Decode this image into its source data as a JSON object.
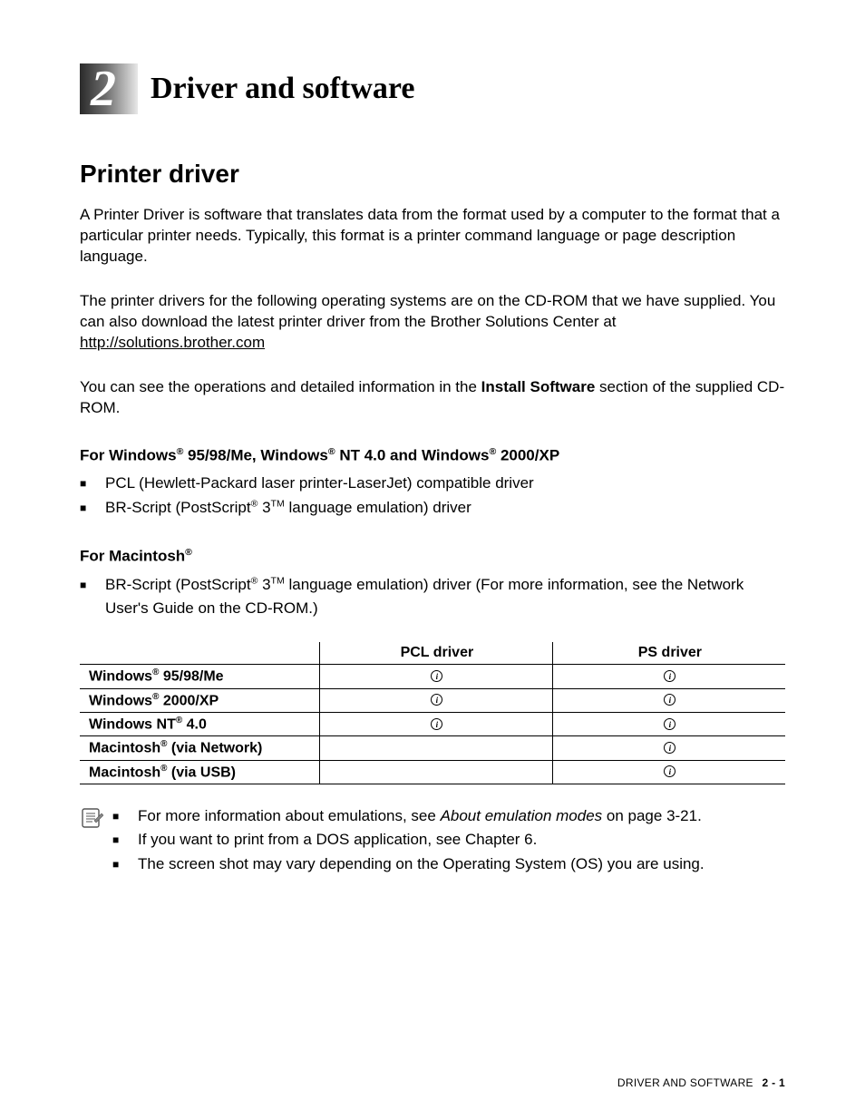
{
  "chapter": {
    "number": "2",
    "title": "Driver and software"
  },
  "section_title": "Printer driver",
  "paragraphs": {
    "p1": "A Printer Driver is software that translates data from the format used by a computer to the format that a particular printer needs. Typically, this format is a printer command language or page description language.",
    "p2a": "The printer drivers for the following operating systems are on the CD-ROM that we have supplied. You can also download the latest printer driver from the Brother Solutions Center at ",
    "p2_link": "http://solutions.brother.com",
    "p3a": "You can see the operations and detailed information in the ",
    "p3b": "Install Software",
    "p3c": " section of the supplied CD-ROM."
  },
  "windows_heading": {
    "a": "For Windows",
    "b": " 95/98/Me, Windows",
    "c": " NT 4.0 and Windows",
    "d": " 2000/XP"
  },
  "windows_bullets": {
    "b1": "PCL (Hewlett-Packard laser printer-LaserJet) compatible driver",
    "b2a": "BR-Script (PostScript",
    "b2b": " 3",
    "b2c": " language emulation) driver"
  },
  "mac_heading": "For Macintosh",
  "mac_bullets": {
    "b1a": "BR-Script (PostScript",
    "b1b": " 3",
    "b1c": " language emulation) driver (For more information, see the Network User's Guide on the CD-ROM.)"
  },
  "table": {
    "headers": {
      "col1": "",
      "col2": "PCL driver",
      "col3": "PS driver"
    },
    "rows": [
      {
        "label_a": "Windows",
        "label_b": " 95/98/Me",
        "pcl": true,
        "ps": true
      },
      {
        "label_a": "Windows",
        "label_b": " 2000/XP",
        "pcl": true,
        "ps": true
      },
      {
        "label_a": "Windows NT",
        "label_b": " 4.0",
        "pcl": true,
        "ps": true
      },
      {
        "label_a": "Macintosh",
        "label_b": " (via Network)",
        "pcl": false,
        "ps": true
      },
      {
        "label_a": "Macintosh",
        "label_b": " (via USB)",
        "pcl": false,
        "ps": true
      }
    ]
  },
  "notes": {
    "n1a": "For more information about emulations, see ",
    "n1b": "About emulation modes",
    "n1c": " on page 3-21.",
    "n2": "If you want to print from a DOS application, see Chapter 6.",
    "n3": "The screen shot may vary depending on the Operating System (OS) you are using."
  },
  "footer": {
    "label": "DRIVER AND SOFTWARE",
    "page": "2 - 1"
  },
  "reg": "®",
  "tm": "TM"
}
